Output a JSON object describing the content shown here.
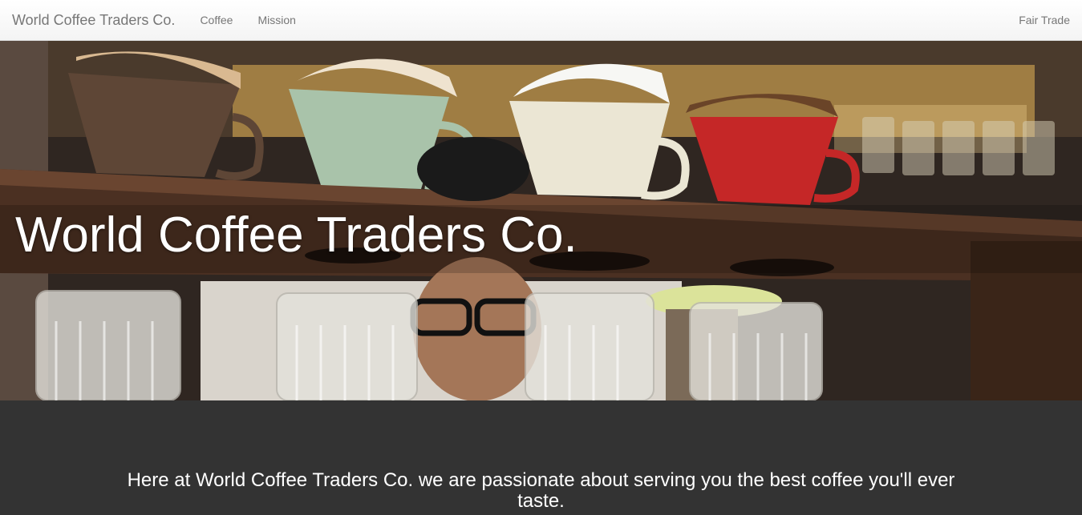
{
  "navbar": {
    "brand": "World Coffee Traders Co.",
    "links": [
      "Coffee",
      "Mission"
    ],
    "right_link": "Fair Trade"
  },
  "hero": {
    "title": "World Coffee Traders Co.",
    "image_description_icon": "coffee-drippers-photo"
  },
  "content": {
    "tagline": "Here at World Coffee Traders Co. we are passionate about serving you the best coffee you'll ever taste."
  },
  "colors": {
    "navbar_bg": "#f8f8f8",
    "nav_text": "#777777",
    "content_bg": "#333333",
    "text_light": "#ffffff"
  }
}
